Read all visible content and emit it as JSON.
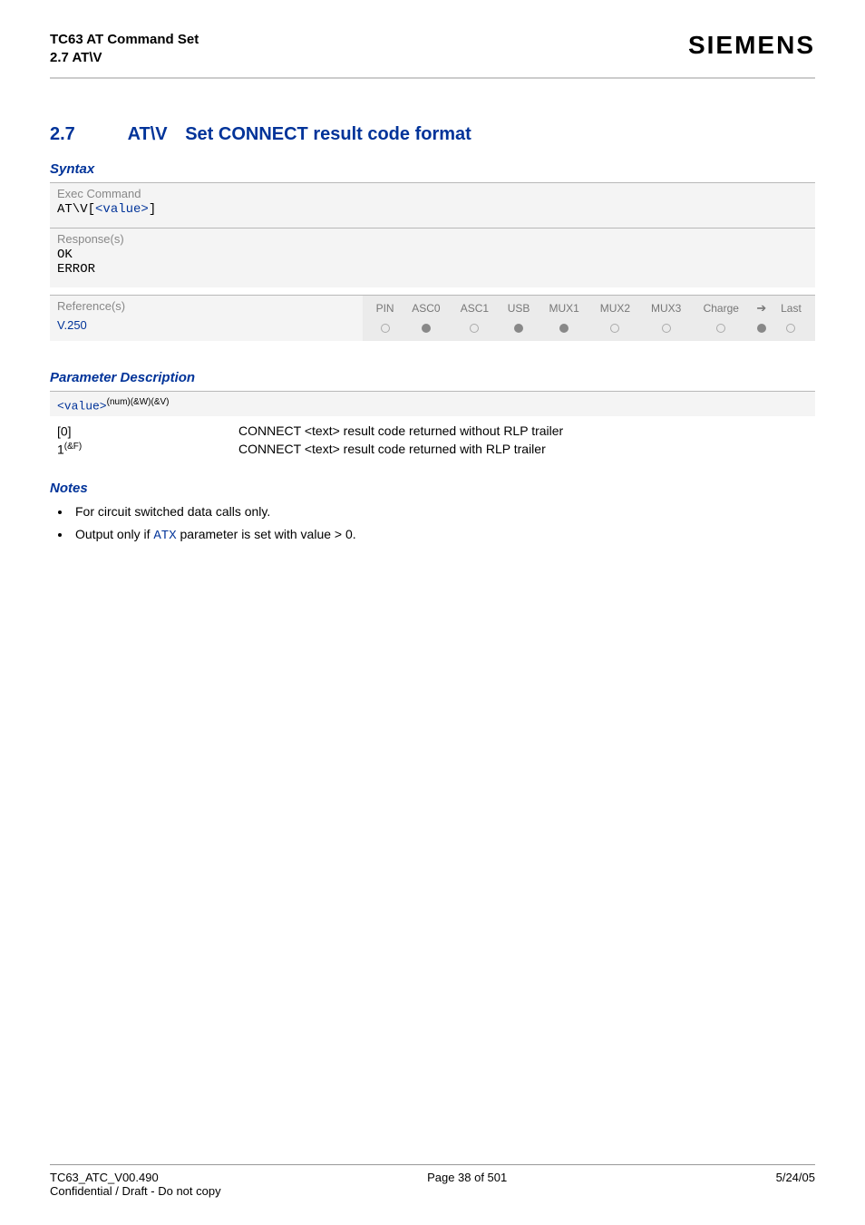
{
  "header": {
    "title": "TC63 AT Command Set",
    "subtitle": "2.7 AT\\V",
    "brand": "SIEMENS"
  },
  "section": {
    "number": "2.7",
    "command": "AT\\V",
    "title": "Set CONNECT result code format"
  },
  "syntax": {
    "heading": "Syntax",
    "exec_label": "Exec Command",
    "exec_cmd_prefix": "AT\\V[",
    "exec_cmd_param": "<value>",
    "exec_cmd_suffix": "]",
    "response_label": "Response(s)",
    "response_ok": "OK",
    "response_error": "ERROR",
    "reference_label": "Reference(s)",
    "reference_value": "V.250",
    "pin_headers": [
      "PIN",
      "ASC0",
      "ASC1",
      "USB",
      "MUX1",
      "MUX2",
      "MUX3",
      "Charge",
      "➔",
      "Last"
    ],
    "pin_values": [
      "open",
      "filled",
      "open",
      "filled",
      "filled",
      "open",
      "open",
      "open",
      "filled",
      "open"
    ]
  },
  "param": {
    "heading": "Parameter Description",
    "name": "<value>",
    "sup": "(num)(&W)(&V)",
    "rows": [
      {
        "value": "[0]",
        "sup": "",
        "desc": "CONNECT <text> result code returned without RLP trailer"
      },
      {
        "value": "1",
        "sup": "(&F)",
        "desc": "CONNECT <text> result code returned with RLP trailer"
      }
    ]
  },
  "notes": {
    "heading": "Notes",
    "items": [
      {
        "pre": "For circuit switched data calls only.",
        "link": "",
        "post": ""
      },
      {
        "pre": "Output only if ",
        "link": "ATX",
        "post": " parameter is set with value > 0."
      }
    ]
  },
  "footer": {
    "doc": "TC63_ATC_V00.490",
    "page": "Page 38 of 501",
    "date": "5/24/05",
    "confidential": "Confidential / Draft - Do not copy"
  }
}
